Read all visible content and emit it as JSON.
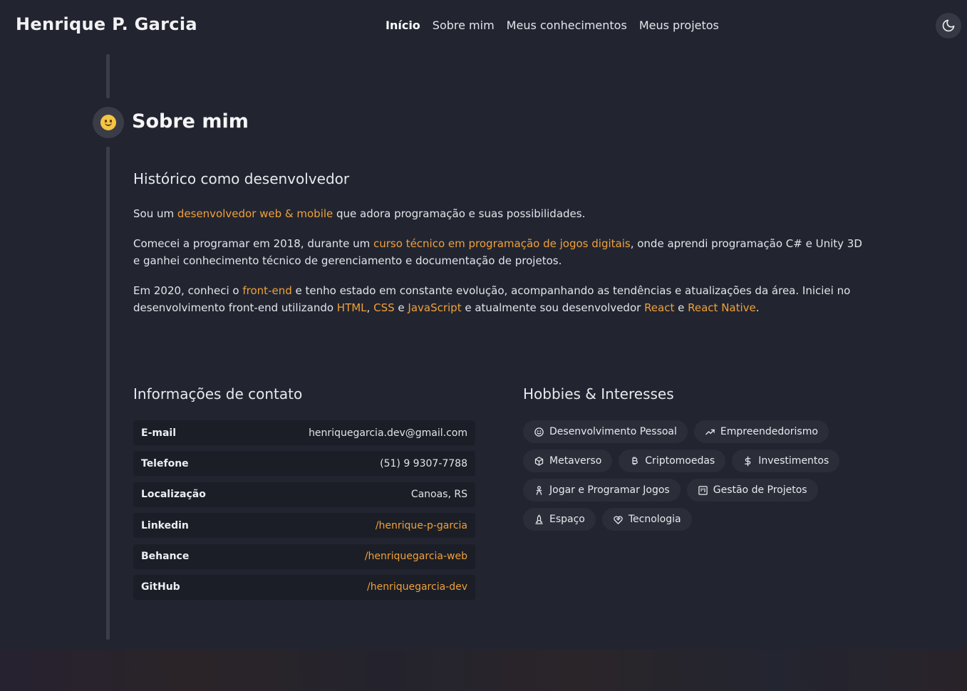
{
  "header": {
    "brand": "Henrique P. Garcia",
    "nav": [
      "Início",
      "Sobre mim",
      "Meus conhecimentos",
      "Meus projetos"
    ],
    "theme_icon": "moon-icon"
  },
  "about": {
    "title": "Sobre mim",
    "icon": "smiley-icon",
    "history_heading": "Histórico como desenvolvedor",
    "p1": {
      "a": "Sou um ",
      "hl1": "desenvolvedor web & mobile",
      "b": " que adora programação e suas possibilidades."
    },
    "p2": {
      "a": "Comecei a programar em 2018, durante um ",
      "hl1": "curso técnico em programação de jogos digitais",
      "b": ", onde aprendi programação C# e Unity 3D e ganhei conhecimento técnico de gerenciamento e documentação de projetos."
    },
    "p3": {
      "a": "Em 2020, conheci o ",
      "hl1": "front-end",
      "b": " e tenho estado em constante evolução, acompanhando as tendências e atualizações da área. Iniciei no desenvolvimento front-end utilizando ",
      "hl2": "HTML",
      "c": ", ",
      "hl3": "CSS",
      "d": " e ",
      "hl4": "JavaScript",
      "e": " e atualmente sou desenvolvedor ",
      "hl5": "React",
      "f": " e ",
      "hl6": "React Native",
      "g": "."
    }
  },
  "contact": {
    "heading": "Informações de contato",
    "rows": [
      {
        "label": "E-mail",
        "value": "henriquegarcia.dev@gmail.com"
      },
      {
        "label": "Telefone",
        "value": "(51) 9 9307-7788"
      },
      {
        "label": "Localização",
        "value": "Canoas, RS"
      },
      {
        "label": "Linkedin",
        "value": "/henrique-p-garcia"
      },
      {
        "label": "Behance",
        "value": "/henriquegarcia-web"
      },
      {
        "label": "GitHub",
        "value": "/henriquegarcia-dev"
      }
    ]
  },
  "hobbies": {
    "heading": "Hobbies & Interesses",
    "items": [
      {
        "label": "Desenvolvimento Pessoal",
        "icon": "smile-icon"
      },
      {
        "label": "Empreendedorismo",
        "icon": "trending-up-icon"
      },
      {
        "label": "Metaverso",
        "icon": "cube-icon"
      },
      {
        "label": "Criptomoedas",
        "icon": "bitcoin-icon"
      },
      {
        "label": "Investimentos",
        "icon": "dollar-icon"
      },
      {
        "label": "Jogar e Programar Jogos",
        "icon": "robot-icon"
      },
      {
        "label": "Gestão de Projetos",
        "icon": "kanban-icon"
      },
      {
        "label": "Espaço",
        "icon": "rocket-icon"
      },
      {
        "label": "Tecnologia",
        "icon": "heart-circuit-icon"
      }
    ]
  },
  "colors": {
    "background": "#222530",
    "accent": "#f0a03a",
    "row_bg": "#1b1e26",
    "chip_bg": "#2b2e39"
  }
}
